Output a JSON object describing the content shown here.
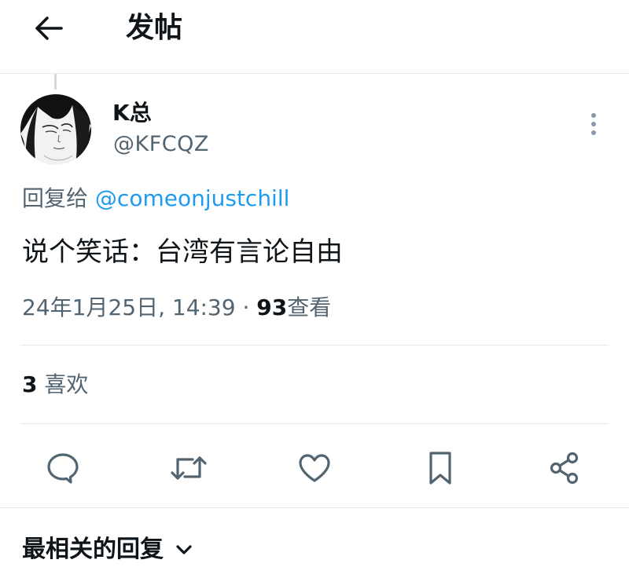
{
  "header": {
    "title": "发帖",
    "back_icon": "arrow-left-icon"
  },
  "author": {
    "display_name": "K总",
    "handle": "@KFCQZ"
  },
  "reply": {
    "prefix": "回复给",
    "mention": "@comeonjustchill"
  },
  "tweet": {
    "text": "说个笑话：台湾有言论自由"
  },
  "meta": {
    "timestamp": "24年1月25日, 14:39",
    "separator": "·",
    "views_count": "93",
    "views_label": "查看"
  },
  "stats": {
    "likes_count": "3",
    "likes_label": "喜欢"
  },
  "actions": [
    {
      "name": "reply",
      "icon": "comment-icon"
    },
    {
      "name": "retweet",
      "icon": "retweet-icon"
    },
    {
      "name": "like",
      "icon": "heart-icon"
    },
    {
      "name": "bookmark",
      "icon": "bookmark-icon"
    },
    {
      "name": "share",
      "icon": "share-icon"
    }
  ],
  "replies": {
    "sort_label": "最相关的回复"
  },
  "colors": {
    "text": "#0f1419",
    "secondary": "#536471",
    "link": "#1d9bf0",
    "icon": "#536471",
    "divider": "#e6e9ec"
  }
}
